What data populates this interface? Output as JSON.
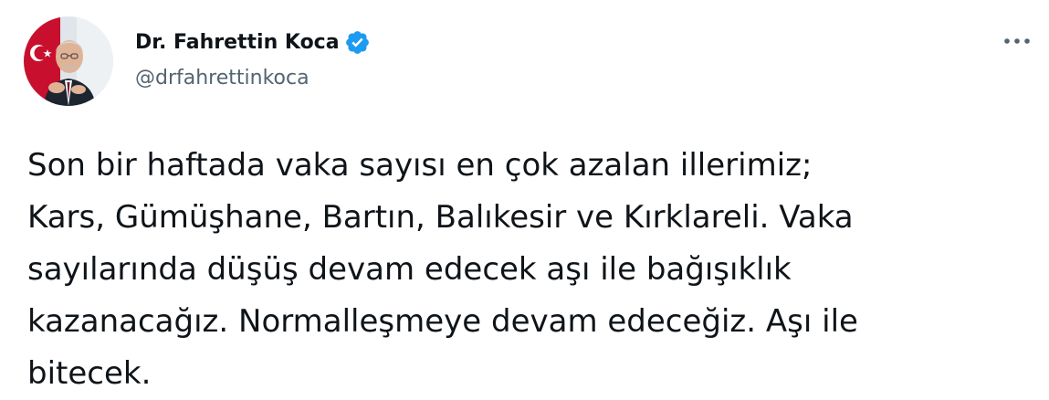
{
  "author": {
    "display_name": "Dr. Fahrettin Koca",
    "handle": "@drfahrettinkoca",
    "verified": true,
    "avatar_icon": "profile-photo"
  },
  "more_icon": "more-options-icon",
  "tweet": {
    "lines": [
      "Son bir haftada vaka sayısı en çok azalan illerimiz;",
      "Kars, Gümüşhane, Bartın, Balıkesir ve Kırklareli. Vaka",
      "sayılarında düşüş devam edecek aşı ile bağışıklık",
      "kazanacağız. Normalleşmeye devam edeceğiz. Aşı ile",
      "bitecek."
    ]
  },
  "colors": {
    "verified_badge": "#1d9bf0",
    "text_primary": "#0f1419",
    "text_secondary": "#536471"
  }
}
